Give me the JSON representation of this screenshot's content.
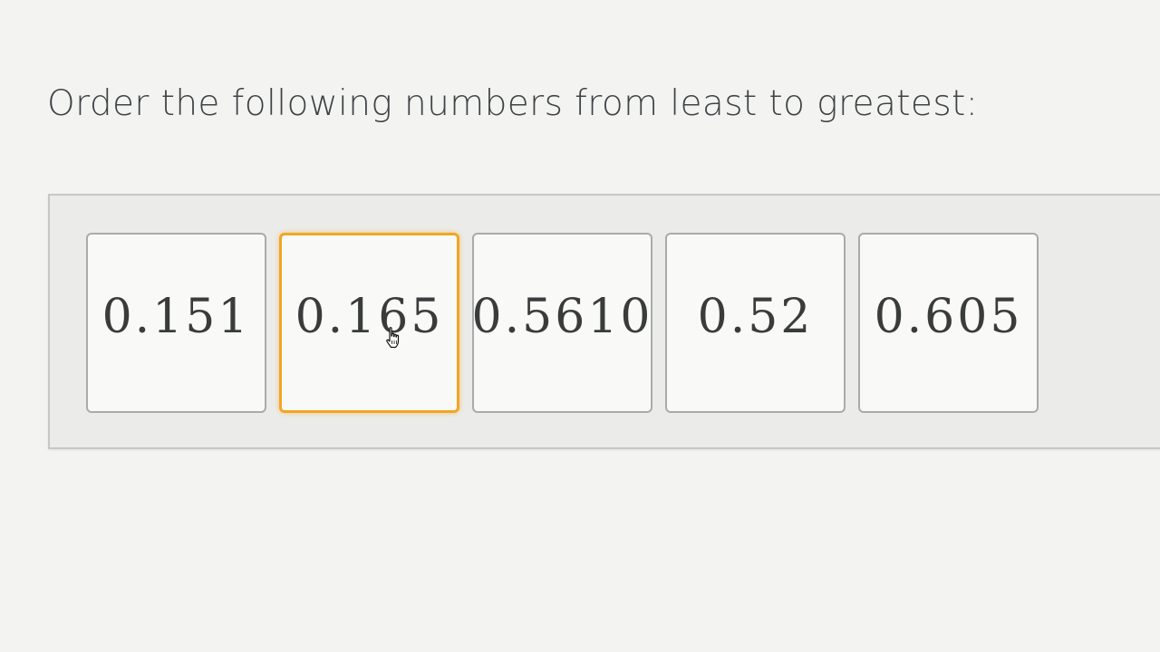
{
  "question": {
    "prompt": "Order the following numbers from least to greatest:"
  },
  "cards": [
    {
      "value": "0.151",
      "selected": false
    },
    {
      "value": "0.165",
      "selected": true
    },
    {
      "value": "0.5610",
      "selected": false
    },
    {
      "value": "0.52",
      "selected": false
    },
    {
      "value": "0.605",
      "selected": false
    }
  ],
  "colors": {
    "background": "#f3f4f2",
    "tray": "#ebecea",
    "selected_border": "#f2a623",
    "card_border": "#a9abab",
    "text": "#3f4346"
  },
  "cursor": {
    "icon": "hand-pointer-icon"
  }
}
